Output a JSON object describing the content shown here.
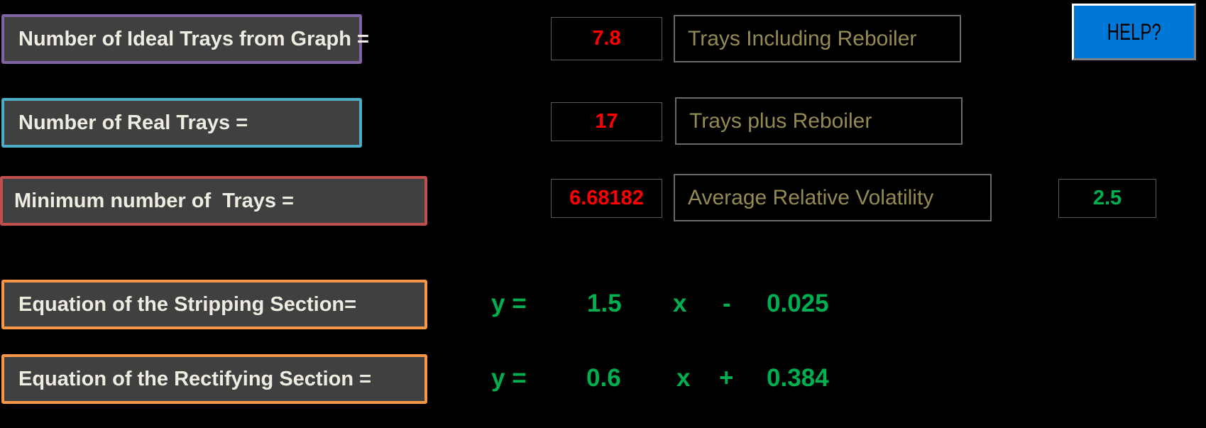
{
  "colors": {
    "background": "#000000",
    "label_fill": "#404040",
    "label_text": "#EEECE1",
    "result_red": "#FF0000",
    "result_green": "#00B050",
    "desc_text": "#948A54",
    "help_blue": "#0078D7",
    "border_ideal": "#8064A2",
    "border_real": "#4BACC6",
    "border_min": "#C0504D",
    "border_eq": "#F79646"
  },
  "rows": {
    "ideal_trays": {
      "label": "Number of Ideal Trays from Graph =",
      "value": "7.8",
      "description": "Trays Including Reboiler"
    },
    "real_trays": {
      "label": "Number of Real Trays =",
      "value": "17",
      "description": "Trays plus Reboiler"
    },
    "minimum_trays": {
      "label": "Minimum number of  Trays =",
      "value": "6.68182",
      "description": "Average Relative Volatility",
      "volatility_value": "2.5"
    }
  },
  "equations": {
    "stripping": {
      "label": "Equation of the Stripping Section=",
      "y_eq": "y =",
      "slope": "1.5",
      "x": "x",
      "sign": "-",
      "intercept": "0.025"
    },
    "rectifying": {
      "label": "Equation of the Rectifying Section =",
      "y_eq": "y =",
      "slope": "0.6",
      "x": "x",
      "sign": "+",
      "intercept": "0.384"
    }
  },
  "help_button": {
    "label": "HELP?"
  }
}
